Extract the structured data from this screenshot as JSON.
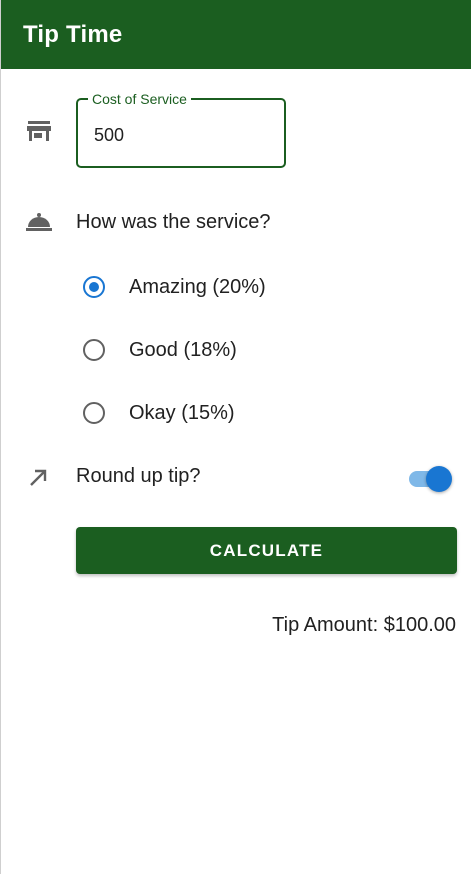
{
  "app_bar": {
    "title": "Tip Time",
    "color": "#1b5e20"
  },
  "cost_field": {
    "icon": "storefront-icon",
    "label": "Cost of Service",
    "value": "500"
  },
  "service": {
    "icon": "room-service-icon",
    "question": "How was the service?",
    "options": [
      {
        "label": "Amazing (20%)",
        "checked": true
      },
      {
        "label": "Good (18%)",
        "checked": false
      },
      {
        "label": "Okay (15%)",
        "checked": false
      }
    ]
  },
  "round_up": {
    "icon": "trending-up-icon",
    "label": "Round up tip?",
    "enabled": true
  },
  "calculate_button": {
    "label": "CALCULATE"
  },
  "result": {
    "text": "Tip Amount: $100.00"
  },
  "colors": {
    "primary": "#1b5e20",
    "accent": "#1976d2"
  }
}
